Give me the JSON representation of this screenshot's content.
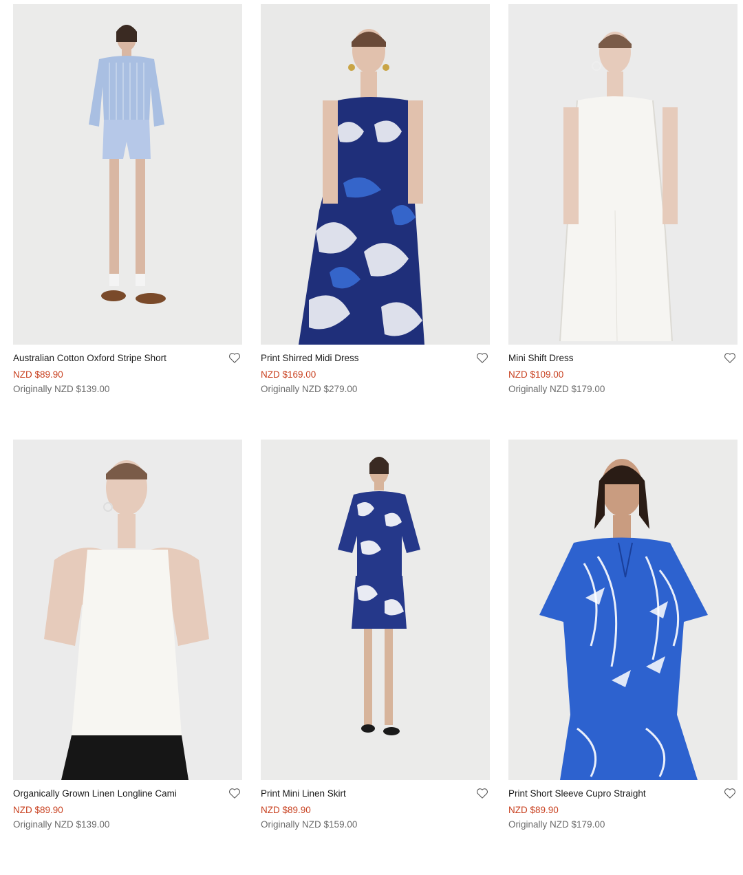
{
  "products": [
    {
      "name": "Australian Cotton Oxford Stripe Short",
      "sale_price": "NZD $89.90",
      "original_label": "Originally",
      "original_price": "NZD $139.00",
      "colors": {
        "bg": "#ebebea",
        "main": "#a9bfe2",
        "accent": "#ffffff"
      }
    },
    {
      "name": "Print Shirred Midi Dress",
      "sale_price": "NZD $169.00",
      "original_label": "Originally",
      "original_price": "NZD $279.00",
      "colors": {
        "bg": "#e9e9e8",
        "main": "#1f2f7a",
        "accent": "#3a6fd8"
      }
    },
    {
      "name": "Mini Shift Dress",
      "sale_price": "NZD $109.00",
      "original_label": "Originally",
      "original_price": "NZD $179.00",
      "colors": {
        "bg": "#ebebeb",
        "main": "#f6f5f2",
        "accent": "#dcdad4"
      }
    },
    {
      "name": "Organically Grown Linen Longline Cami",
      "sale_price": "NZD $89.90",
      "original_label": "Originally",
      "original_price": "NZD $139.00",
      "colors": {
        "bg": "#ebebeb",
        "main": "#f7f6f2",
        "accent": "#161616"
      }
    },
    {
      "name": "Print Mini Linen Skirt",
      "sale_price": "NZD $89.90",
      "original_label": "Originally",
      "original_price": "NZD $159.00",
      "colors": {
        "bg": "#ebebea",
        "main": "#25388a",
        "accent": "#ffffff"
      }
    },
    {
      "name": "Print Short Sleeve Cupro Straight",
      "sale_price": "NZD $89.90",
      "original_label": "Originally",
      "original_price": "NZD $179.00",
      "colors": {
        "bg": "#ebebea",
        "main": "#2d62cf",
        "accent": "#ffffff"
      }
    }
  ]
}
